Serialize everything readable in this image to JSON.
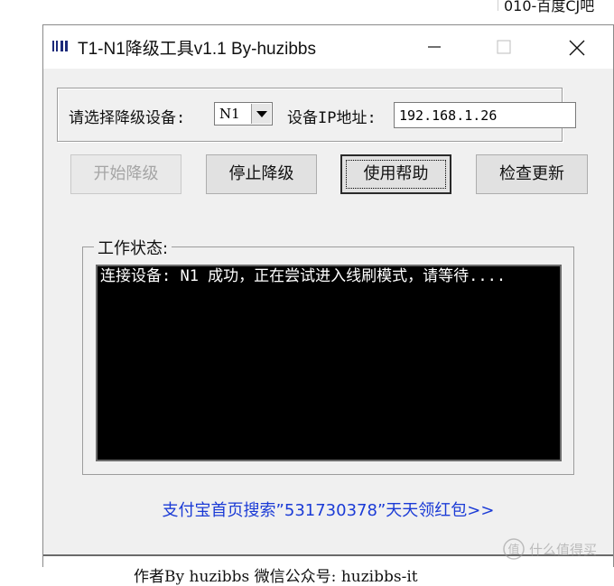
{
  "background": {
    "snippet": "010-百度CJ吧"
  },
  "window": {
    "title": "T1-N1降级工具v1.1 By-huzibbs",
    "controls": {
      "minimize": "—",
      "maximize": "☐",
      "close": "✕"
    }
  },
  "device_group": {
    "select_label": "请选择降级设备:",
    "selected_device": "N1",
    "ip_label": "设备IP地址:",
    "ip_value": "192.168.1.26"
  },
  "buttons": {
    "start": "开始降级",
    "stop": "停止降级",
    "help": "使用帮助",
    "update": "检查更新"
  },
  "status": {
    "label": "工作状态:",
    "log": "连接设备: N1 成功，正在尝试进入线刷模式，请等待...."
  },
  "promo_text": "支付宝首页搜索”531730378”天天领红包>>",
  "footer_text": "作者By huzibbs 微信公众号: huzibbs-it",
  "watermark_text": "什么值得买",
  "colors": {
    "window_bg": "#f0f0f0",
    "console_bg": "#000000",
    "console_text": "#ffffff",
    "link": "#1b3bd6",
    "disabled_text": "#a5a5a5"
  }
}
